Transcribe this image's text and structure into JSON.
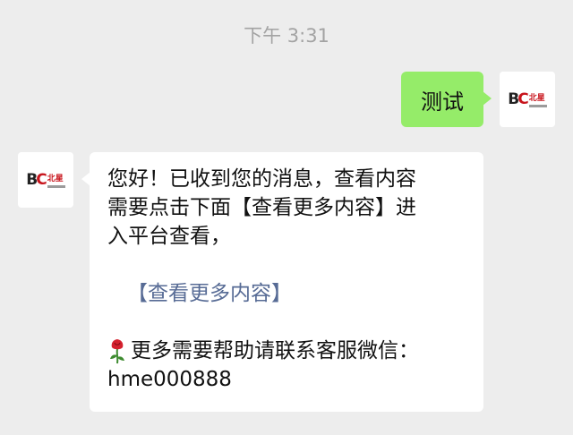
{
  "timestamp": "下午 3:31",
  "avatar": {
    "logo_letters": "BC",
    "logo_cn": "北星"
  },
  "sent_message": {
    "text": "测试"
  },
  "reply": {
    "lines": [
      "您好！已收到您的消息，查看内容",
      "需要点击下面【查看更多内容】进",
      "入平台查看，"
    ],
    "link_text": "【查看更多内容】",
    "contact_text": "更多需要帮助请联系客服微信：",
    "wechat_id": "hme000888"
  },
  "icons": {
    "contact_icon": "rose-icon"
  },
  "colors": {
    "sent_bubble": "#95ec69",
    "received_bubble": "#ffffff",
    "link": "#576b95",
    "background": "#ededed"
  }
}
